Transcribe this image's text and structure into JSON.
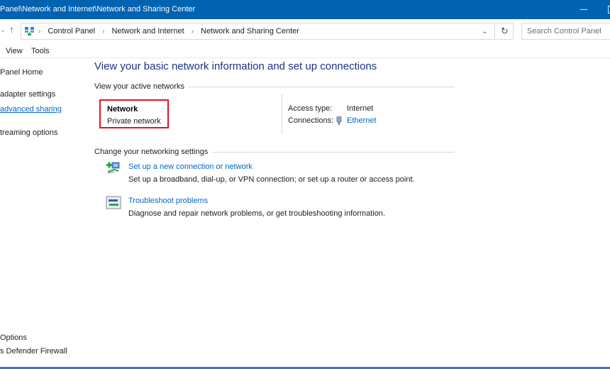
{
  "window": {
    "title": "Panel\\Network and Internet\\Network and Sharing Center",
    "controls": {
      "minimize": "minimize",
      "maximize": "maximize"
    }
  },
  "address_bar": {
    "icon": "control-panel-icon",
    "breadcrumbs": [
      "Control Panel",
      "Network and Internet",
      "Network and Sharing Center"
    ],
    "separator": ">",
    "dropdown_glyph": "⌄",
    "refresh_glyph": "↻"
  },
  "search": {
    "placeholder": "Search Control Panel",
    "value": ""
  },
  "menu": {
    "items": [
      "View",
      "Tools"
    ]
  },
  "sidebar": {
    "items": [
      {
        "label": "Panel Home",
        "is_link": false
      },
      {
        "label": "adapter settings",
        "is_link": false
      },
      {
        "label": "advanced sharing",
        "is_link": true
      },
      {
        "label": "treaming options",
        "is_link": false
      }
    ],
    "see_also": [
      {
        "label": "Options"
      },
      {
        "label": "s Defender Firewall"
      }
    ]
  },
  "main": {
    "title": "View your basic network information and set up connections",
    "active_networks": {
      "heading": "View your active networks",
      "network_name": "Network",
      "network_category": "Private network",
      "highlight_color": "#e81123",
      "access_type_label": "Access type:",
      "access_type_value": "Internet",
      "connections_label": "Connections:",
      "connections_value": "Ethernet"
    },
    "change_settings": {
      "heading": "Change your networking settings",
      "tasks": [
        {
          "icon": "new-connection-icon",
          "link": "Set up a new connection or network",
          "description": "Set up a broadband, dial-up, or VPN connection; or set up a router or access point."
        },
        {
          "icon": "troubleshoot-icon",
          "link": "Troubleshoot problems",
          "description": "Diagnose and repair network problems, or get troubleshooting information."
        }
      ]
    }
  },
  "colors": {
    "titlebar": "#0063b1",
    "link": "#0066cc",
    "heading": "#1e3287",
    "accent_border": "#2b7cd3"
  }
}
